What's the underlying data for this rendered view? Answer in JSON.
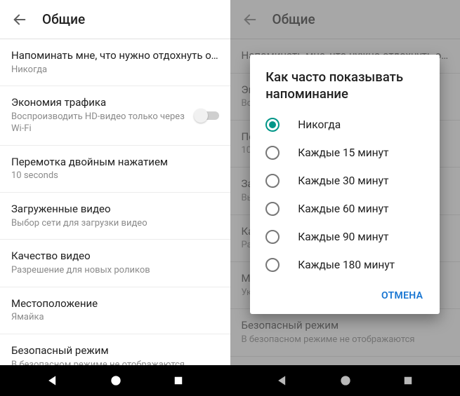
{
  "left": {
    "appbar": {
      "title": "Общие"
    },
    "items": [
      {
        "title": "Напоминать мне, что нужно отдохнуть от…",
        "sub": "Никогда"
      },
      {
        "title": "Экономия трафика",
        "sub": "Воспроизводить HD-видео только через Wi-Fi",
        "switch": true
      },
      {
        "title": "Перемотка двойным нажатием",
        "sub": "10 seconds"
      },
      {
        "title": "Загруженные видео",
        "sub": "Выбор сети для загрузки видео"
      },
      {
        "title": "Качество видео",
        "sub": "Разрешение для новых роликов"
      },
      {
        "title": "Местоположение",
        "sub": "Ямайка"
      },
      {
        "title": "Безопасный режим",
        "sub": "В безопасном режиме не отображаются"
      }
    ]
  },
  "right": {
    "appbar": {
      "title": "Общие"
    },
    "items": [
      {
        "title": "Напоминать мне, что нужно отдохнуть от…",
        "sub": ""
      },
      {
        "title": "Эк",
        "sub": "Вос"
      },
      {
        "title": "Пе",
        "sub": "10"
      },
      {
        "title": "За",
        "sub": "Вы"
      },
      {
        "title": "Ка",
        "sub": "Ра"
      },
      {
        "title": "Ме",
        "sub": "Ук"
      },
      {
        "title": "Безопасный режим",
        "sub": "В безопасном режиме не отображаются"
      }
    ]
  },
  "dialog": {
    "title": "Как часто показывать напоминание",
    "options": [
      {
        "label": "Никогда",
        "checked": true
      },
      {
        "label": "Каждые 15 минут",
        "checked": false
      },
      {
        "label": "Каждые 30 минут",
        "checked": false
      },
      {
        "label": "Каждые 60 минут",
        "checked": false
      },
      {
        "label": "Каждые 90 минут",
        "checked": false
      },
      {
        "label": "Каждые 180 минут",
        "checked": false
      }
    ],
    "cancel": "ОТМЕНА"
  }
}
